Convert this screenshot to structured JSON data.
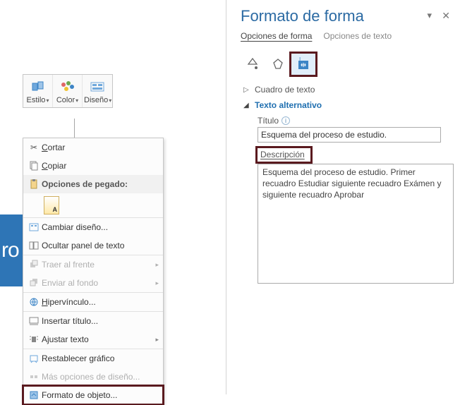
{
  "mini_toolbar": {
    "style": "Estilo",
    "color": "Color",
    "design": "Diseño"
  },
  "blue_shape_text": "ro",
  "context_menu": {
    "cut": "Cortar",
    "copy": "Copiar",
    "paste_section": "Opciones de pegado:",
    "change_design": "Cambiar diseño...",
    "hide_text_panel": "Ocultar panel de texto",
    "bring_front": "Traer al frente",
    "send_back": "Enviar al fondo",
    "hyperlink": "Hipervínculo...",
    "insert_title": "Insertar título...",
    "adjust_text": "Ajustar texto",
    "reset_graphic": "Restablecer gráfico",
    "more_design_options": "Más opciones de diseño...",
    "format_object": "Formato de objeto..."
  },
  "panel": {
    "title": "Formato de forma",
    "pin_glyph": "▾",
    "close_glyph": "✕",
    "tabs": {
      "shape_options": "Opciones de forma",
      "text_options": "Opciones de texto"
    },
    "sections": {
      "text_box": "Cuadro de texto",
      "alt_text": "Texto alternativo"
    },
    "fields": {
      "title_label": "Título",
      "title_value": "Esquema del proceso de estudio.",
      "description_label": "Descripción",
      "description_value": "Esquema del proceso de estudio. Primer recuadro Estudiar siguiente recuadro Exámen y siguiente recuadro Aprobar"
    }
  }
}
